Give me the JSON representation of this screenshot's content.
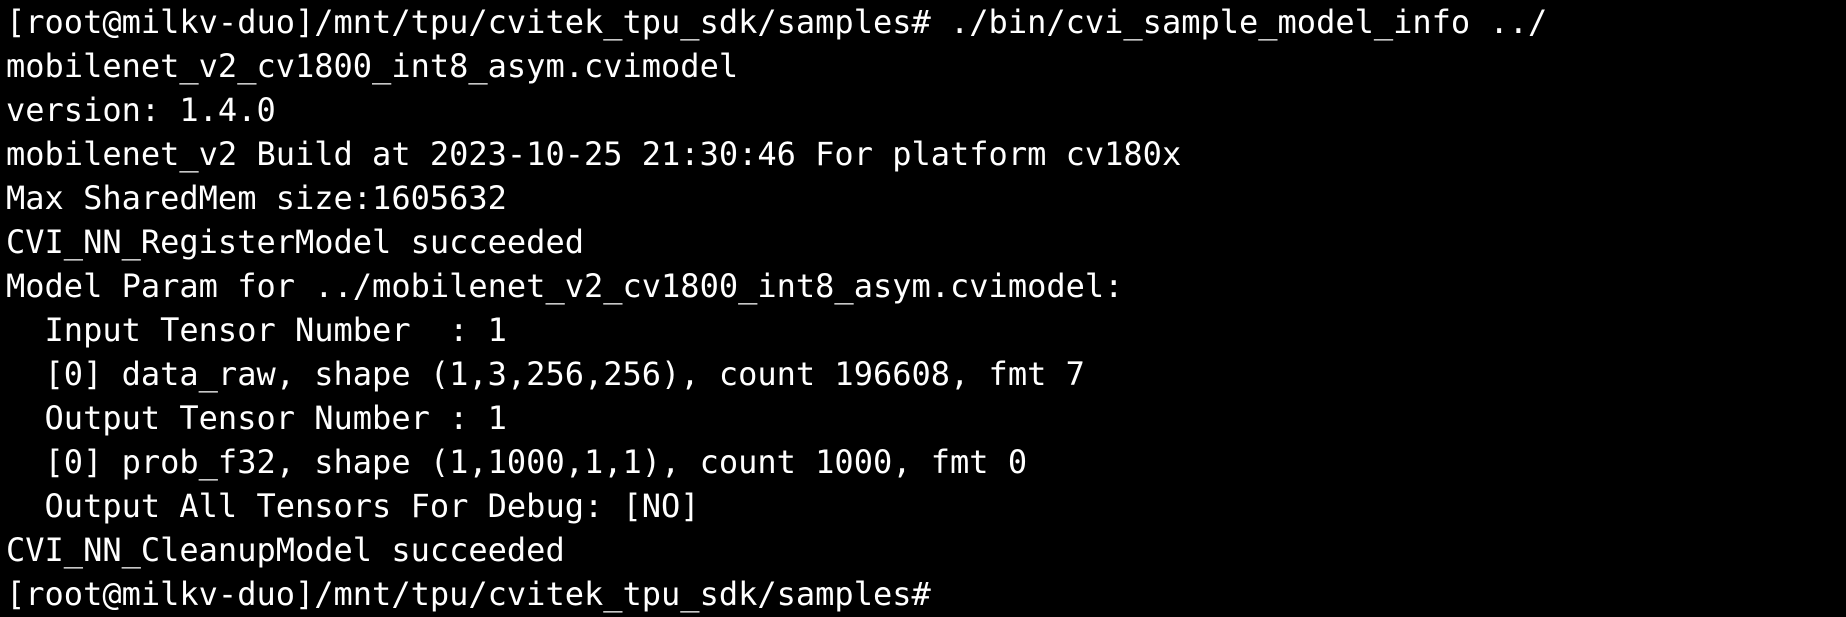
{
  "terminal": {
    "background_color": "#000000",
    "text_color": "#ffffff",
    "lines": [
      "[root@milkv-duo]/mnt/tpu/cvitek_tpu_sdk/samples# ./bin/cvi_sample_model_info ../",
      "mobilenet_v2_cv1800_int8_asym.cvimodel",
      "version: 1.4.0",
      "mobilenet_v2 Build at 2023-10-25 21:30:46 For platform cv180x",
      "Max SharedMem size:1605632",
      "CVI_NN_RegisterModel succeeded",
      "Model Param for ../mobilenet_v2_cv1800_int8_asym.cvimodel:",
      "  Input Tensor Number  : 1",
      "  [0] data_raw, shape (1,3,256,256), count 196608, fmt 7",
      "  Output Tensor Number : 1",
      "  [0] prob_f32, shape (1,1000,1,1), count 1000, fmt 0",
      "  Output All Tensors For Debug: [NO]",
      "CVI_NN_CleanupModel succeeded",
      "[root@milkv-duo]/mnt/tpu/cvitek_tpu_sdk/samples# "
    ]
  }
}
